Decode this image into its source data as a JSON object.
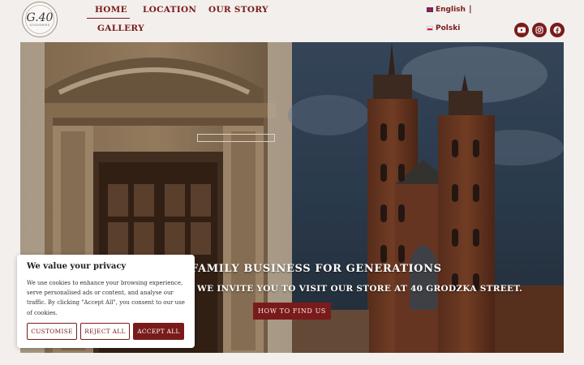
{
  "logo": {
    "mark": "G.40",
    "sub": "SOUVENIRS"
  },
  "nav": {
    "home": "HOME",
    "location": "LOCATION",
    "story": "OUR STORY",
    "gallery": "GALLERY"
  },
  "languages": {
    "english": "English",
    "separator": "|",
    "polski": "Polski"
  },
  "social": [
    "youtube-icon",
    "instagram-icon",
    "facebook-icon"
  ],
  "hero": {
    "title": "FAMILY BUSINESS FOR GENERATIONS",
    "subtitle": "WE INVITE YOU TO VISIT OUR STORE AT 40 GRODZKA STREET.",
    "button": "HOW TO FIND US"
  },
  "cookie": {
    "title": "We value your privacy",
    "text": "We use cookies to enhance your browsing experience, serve personalised ads or content, and analyse our traffic. By clicking \"Accept All\", you consent to our use of cookies.",
    "customise": "CUSTOMISE",
    "reject": "REJECT ALL",
    "accept": "ACCEPT ALL"
  },
  "colors": {
    "brand": "#7a1b1b",
    "page_bg": "#f3efec"
  }
}
